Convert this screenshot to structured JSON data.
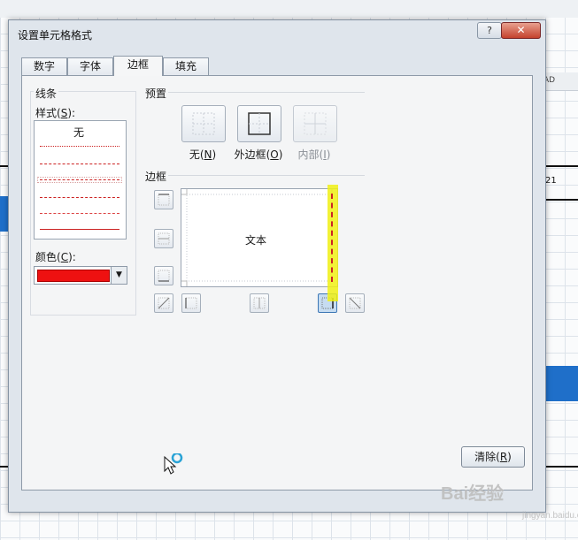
{
  "sheet": {
    "column_label": "AD",
    "cell_value": "21"
  },
  "dialog": {
    "title": "设置单元格格式",
    "help_symbol": "?",
    "close_symbol": "✕",
    "tabs": [
      {
        "label": "数字"
      },
      {
        "label": "字体"
      },
      {
        "label": "边框"
      },
      {
        "label": "填充"
      }
    ],
    "active_tab": "边框"
  },
  "line": {
    "group_label": "线条",
    "style_label": "样式",
    "style_key": "S",
    "style_none": "无",
    "color_label": "颜色",
    "color_key": "C",
    "selected_color": "#EE1111"
  },
  "presets": {
    "group_label": "预置",
    "items": [
      {
        "label": "无",
        "key": "N"
      },
      {
        "label": "外边框",
        "key": "O"
      },
      {
        "label": "内部",
        "key": "I"
      }
    ]
  },
  "border": {
    "group_label": "边框",
    "preview_text": "文本"
  },
  "buttons": {
    "clear_label": "清除",
    "clear_key": "R"
  },
  "watermark": {
    "brand": "Bai经验",
    "domain": "jingyan.baidu.com"
  }
}
